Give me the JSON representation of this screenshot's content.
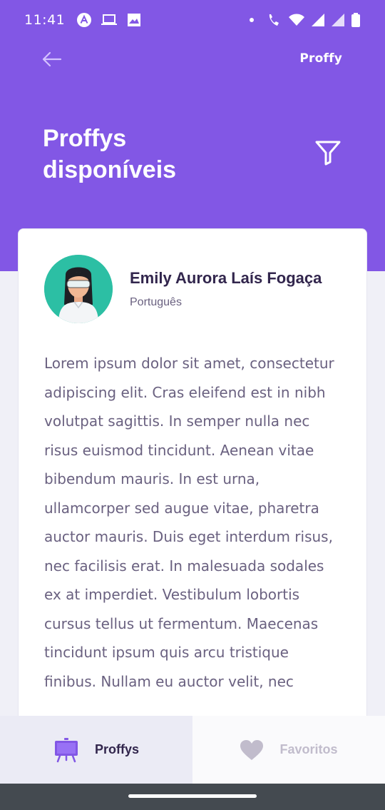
{
  "status_bar": {
    "time": "11:41",
    "left_icons": [
      "a-logo-icon",
      "laptop-icon",
      "gallery-icon"
    ],
    "right_icons": [
      "notification-dot-icon",
      "wifi-call-icon",
      "wifi-icon",
      "signal-icon",
      "signal-4g-icon",
      "battery-icon"
    ]
  },
  "header": {
    "brand": "Proffy",
    "title": "Proffys disponíveis",
    "back_icon": "arrow-left-icon",
    "filter_icon": "filter-icon"
  },
  "teacher": {
    "name": "Emily Aurora Laís Fogaça",
    "subject": "Português",
    "bio": "Lorem ipsum dolor sit amet, consectetur adipiscing elit. Cras eleifend est in nibh volutpat sagittis. In semper nulla nec risus euismod tincidunt. Aenean vitae bibendum mauris. In est urna, ullamcorper sed augue vitae, pharetra auctor mauris. Duis eget interdum risus, nec facilisis erat. In malesuada sodales ex at imperdiet. Vestibulum lobortis cursus tellus ut fermentum. Maecenas tincidunt ipsum quis arcu tristique finibus. Nullam eu auctor velit, nec"
  },
  "tabs": [
    {
      "label": "Proffys",
      "icon": "easel-icon",
      "active": true
    },
    {
      "label": "Favoritos",
      "icon": "heart-icon",
      "active": false
    }
  ],
  "colors": {
    "primary": "#8257e5",
    "background": "#f0f0f7",
    "title_dark": "#32264d",
    "text_base": "#6a6180",
    "tab_inactive": "#c1bccc"
  }
}
